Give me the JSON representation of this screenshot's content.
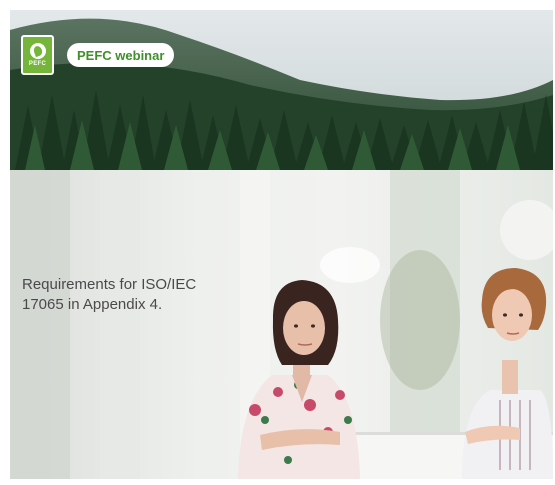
{
  "banner": {
    "logo_text": "PEFC",
    "title": "PEFC webinar",
    "accent": "#74b53a"
  },
  "video": {
    "caption": "Requirements for ISO/IEC\n17065 in Appendix 4."
  }
}
